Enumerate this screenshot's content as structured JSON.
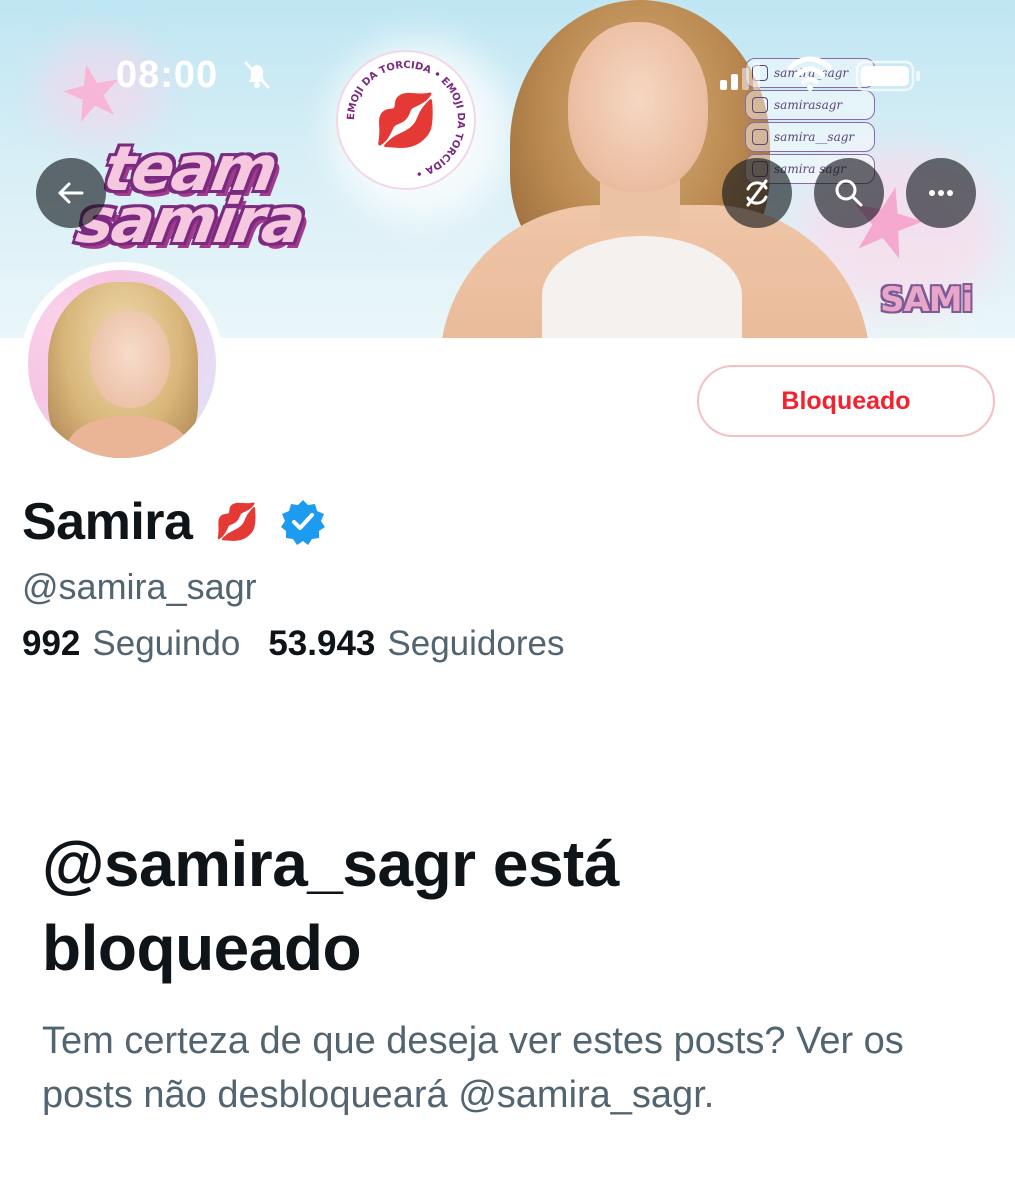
{
  "status_bar": {
    "time": "08:00"
  },
  "banner": {
    "logo_line1": "team",
    "logo_line2": "samira",
    "badge_text": "EMOJI DA TORCIDA • EMOJI DA TORCIDA •",
    "badge_emoji": "💋",
    "socials": [
      {
        "icon": "instagram-icon",
        "label": "samira_sagr"
      },
      {
        "icon": "tiktok-icon",
        "label": "samirasagr"
      },
      {
        "icon": "twitter-icon",
        "label": "samira__sagr"
      },
      {
        "icon": "facebook-icon",
        "label": "samira sagr"
      }
    ],
    "sami_logo": "SAMi"
  },
  "nav": {
    "back_icon": "arrow-left-icon",
    "refresh_icon": "refresh-icon",
    "search_icon": "search-icon",
    "more_icon": "more-dots-icon"
  },
  "profile": {
    "display_name": "Samira",
    "name_emoji": "💋",
    "verified": true,
    "handle": "@samira_sagr",
    "following_count": "992",
    "following_label": "Seguindo",
    "followers_count": "53.943",
    "followers_label": "Seguidores",
    "block_button_label": "Bloqueado"
  },
  "blocked_notice": {
    "title": "@samira_sagr está bloqueado",
    "description": "Tem certeza de que deseja ver estes posts? Ver os posts não desbloqueará @samira_sagr."
  },
  "colors": {
    "text_primary": "#0f1419",
    "text_secondary": "#536471",
    "danger": "#f4212e",
    "danger_border": "#f4c0c5",
    "verified_blue": "#1d9bf0"
  }
}
